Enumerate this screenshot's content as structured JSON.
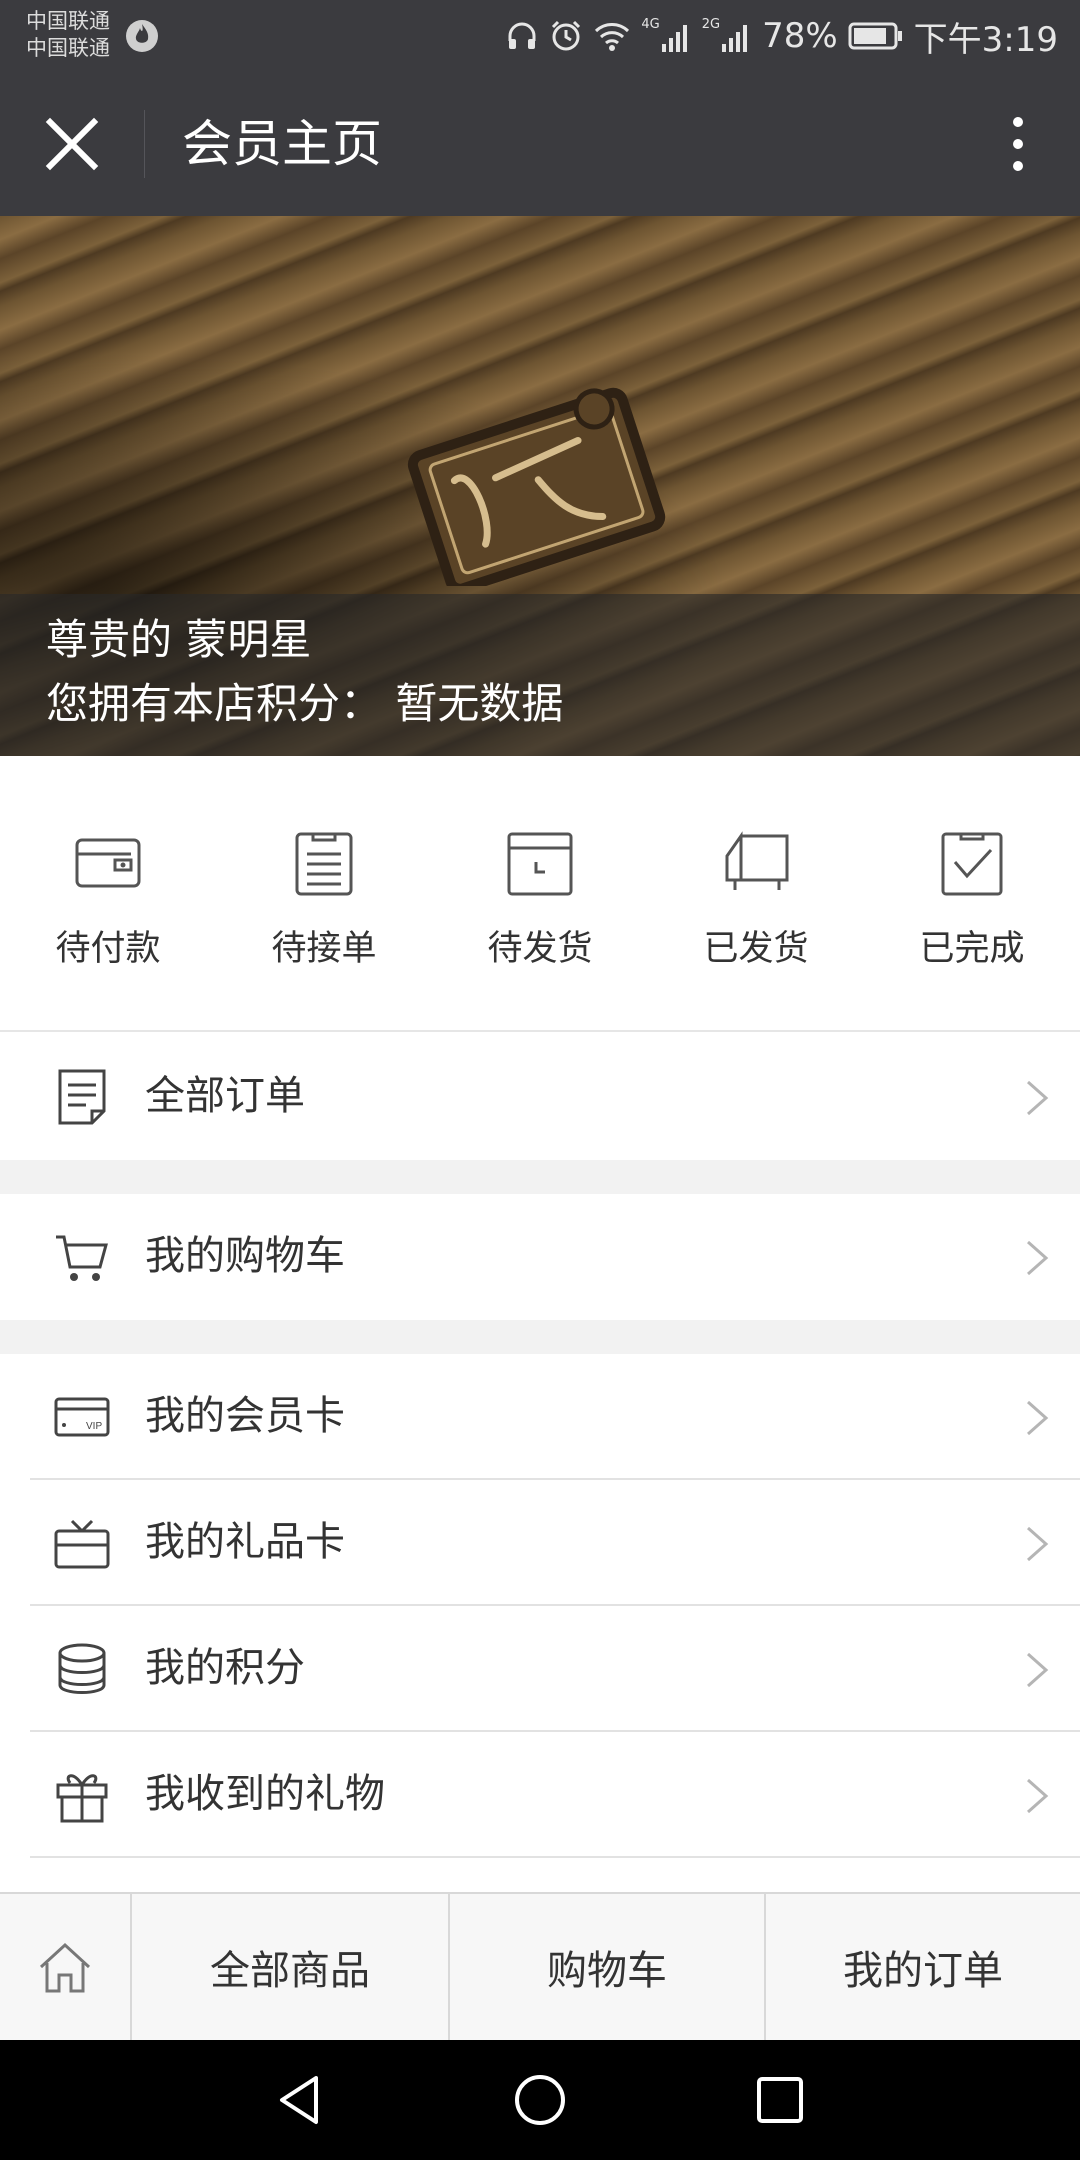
{
  "status_bar": {
    "carrier_1": "中国联通",
    "carrier_2": "中国联通",
    "net_4g": "4G",
    "net_2g": "2G",
    "battery": "78%",
    "time": "下午3:19"
  },
  "header": {
    "title": "会员主页"
  },
  "banner": {
    "greeting": "尊贵的 蒙明星",
    "points_text": "您拥有本店积分：  暂无数据"
  },
  "order_status": [
    {
      "label": "待付款",
      "icon": "wallet-icon"
    },
    {
      "label": "待接单",
      "icon": "clipboard-icon"
    },
    {
      "label": "待发货",
      "icon": "box-icon"
    },
    {
      "label": "已发货",
      "icon": "truck-icon"
    },
    {
      "label": "已完成",
      "icon": "check-clipboard-icon"
    }
  ],
  "menu": {
    "all_orders": "全部订单",
    "cart": "我的购物车",
    "member_card": "我的会员卡",
    "gift_card": "我的礼品卡",
    "points": "我的积分",
    "gifts": "我收到的礼物"
  },
  "tabbar": {
    "all_products": "全部商品",
    "cart": "购物车",
    "my_orders": "我的订单"
  },
  "colors": {
    "bar_bg": "#3b3b3f",
    "page_bg": "#ffffff",
    "gap_bg": "#f2f2f2",
    "text": "#333333"
  }
}
